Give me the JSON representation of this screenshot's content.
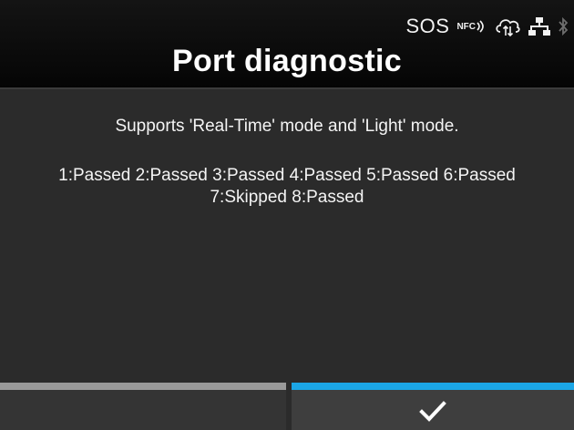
{
  "status_bar": {
    "sos_label": "SOS",
    "nfc_label": "NFC",
    "icons": [
      "nfc-icon",
      "cloud-sync-icon",
      "network-icon",
      "bluetooth-icon"
    ]
  },
  "header": {
    "title": "Port diagnostic"
  },
  "content": {
    "mode_info": "Supports 'Real-Time' mode and 'Light' mode.",
    "results_line1": "1:Passed 2:Passed 3:Passed 4:Passed 5:Passed 6:Passed",
    "results_line2": "7:Skipped 8:Passed"
  },
  "softkeys": {
    "left": {
      "icon": "none"
    },
    "right": {
      "icon": "checkmark-icon"
    }
  },
  "colors": {
    "accent": "#1ba6e6",
    "inactive_bar": "#9a9a9a",
    "background": "#2b2b2b",
    "header_bg": "#0a0a0a"
  }
}
